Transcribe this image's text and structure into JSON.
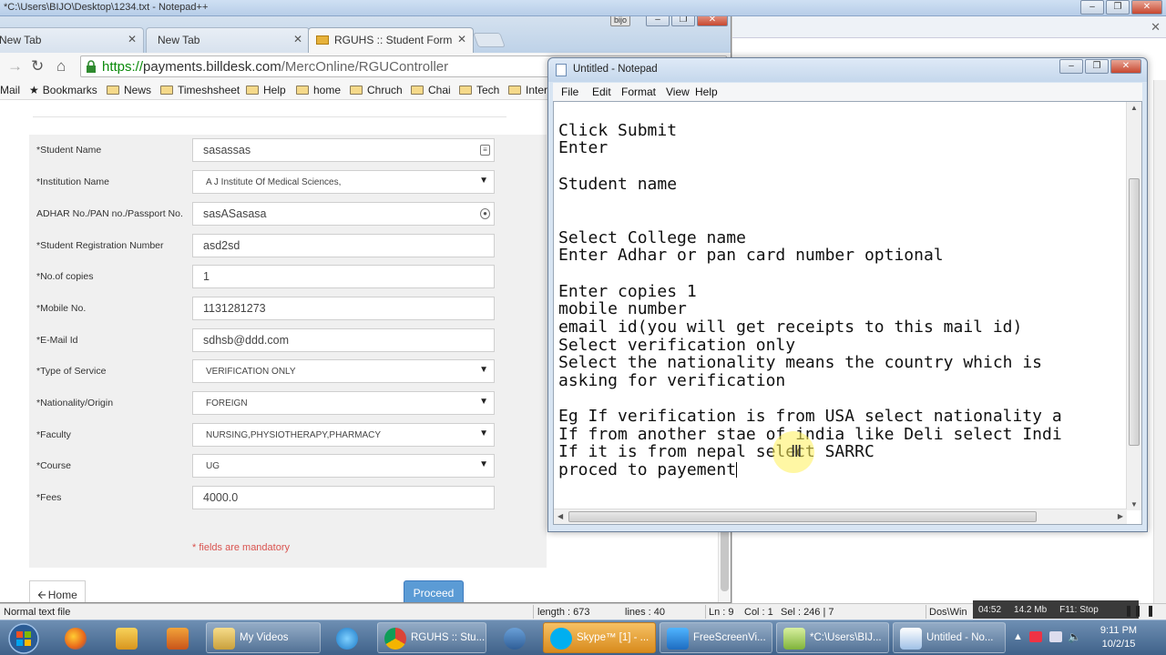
{
  "notepadpp": {
    "title": "*C:\\Users\\BIJO\\Desktop\\1234.txt - Notepad++",
    "statusbar": {
      "type": "Normal text file",
      "length": "length : 673",
      "lines": "lines : 40",
      "ln": "Ln : 9",
      "col": "Col : 1",
      "sel": "Sel : 246 | 7",
      "eol": "Dos\\Win"
    }
  },
  "recorder": {
    "time": "04:52",
    "size": "14.2 Mb",
    "hotkey": "F11: Stop"
  },
  "browser": {
    "tabs": [
      {
        "label": "New Tab",
        "active": false
      },
      {
        "label": "New Tab",
        "active": false
      },
      {
        "label": "RGUHS :: Student Form",
        "active": true
      }
    ],
    "window_badge": "bijo",
    "url": {
      "scheme": "https://",
      "host": "payments.billdesk.com",
      "path": "/MercOnline/RGUController"
    },
    "bookmarks": [
      "Mail",
      "Bookmarks",
      "News",
      "Timeshsheet",
      "Help",
      "home",
      "Chruch",
      "Chai",
      "Tech",
      "Inter"
    ]
  },
  "form": {
    "fields": [
      {
        "label": "*Student Name",
        "value": "sasassas",
        "kind": "text",
        "icon": "contact-card-icon"
      },
      {
        "label": "*Institution Name",
        "value": "A J Institute Of Medical Sciences,",
        "kind": "select"
      },
      {
        "label": "ADHAR No./PAN no./Passport No.",
        "value": "sasASasasa",
        "kind": "text",
        "icon": "key-icon"
      },
      {
        "label": "*Student Registration Number",
        "value": "asd2sd",
        "kind": "text"
      },
      {
        "label": "*No.of copies",
        "value": "1",
        "kind": "text"
      },
      {
        "label": "*Mobile No.",
        "value": "1131281273",
        "kind": "text"
      },
      {
        "label": "*E-Mail Id",
        "value": "sdhsb@ddd.com",
        "kind": "text"
      },
      {
        "label": "*Type of Service",
        "value": "VERIFICATION ONLY",
        "kind": "select"
      },
      {
        "label": "*Nationality/Origin",
        "value": "FOREIGN",
        "kind": "select"
      },
      {
        "label": "*Faculty",
        "value": "NURSING,PHYSIOTHERAPY,PHARMACY",
        "kind": "select"
      },
      {
        "label": "*Course",
        "value": "UG",
        "kind": "select"
      },
      {
        "label": "*Fees",
        "value": "4000.0",
        "kind": "text"
      }
    ],
    "mandatory_note": "* fields are mandatory",
    "home_button": "Home",
    "proceed_button": "Proceed"
  },
  "notepad": {
    "title": "Untitled - Notepad",
    "menu": [
      "File",
      "Edit",
      "Format",
      "View",
      "Help"
    ],
    "lines": [
      "Click Submit",
      "Enter",
      "",
      "Student name",
      "",
      "",
      "Select College name",
      "Enter Adhar or pan card number optional",
      "",
      "Enter copies 1",
      "mobile number",
      "email id(you will get receipts to this mail id)",
      "Select verification only",
      "Select the nationality means the country which is",
      "asking for verification",
      "",
      "Eg If verification is from USA select nationality a",
      "If from another stae of india like Deli select Indi",
      "If it is from nepal select SARRC",
      "proced to payement"
    ]
  },
  "taskbar": {
    "items": [
      {
        "label": "",
        "icon": "firefox-icon",
        "pinned": true
      },
      {
        "label": "",
        "icon": "outlook-icon",
        "pinned": true
      },
      {
        "label": "",
        "icon": "media-player-icon",
        "pinned": true
      },
      {
        "label": "My Videos",
        "icon": "folder-icon",
        "pinned": false
      },
      {
        "label": "",
        "icon": "internet-explorer-icon",
        "pinned": true
      },
      {
        "label": "RGUHS :: Stu...",
        "icon": "chrome-icon",
        "pinned": false
      },
      {
        "label": "",
        "icon": "link-icon",
        "pinned": true
      },
      {
        "label": "Skype™ [1] - ...",
        "icon": "skype-icon",
        "pinned": false,
        "highlight": true
      },
      {
        "label": "FreeScreenVi...",
        "icon": "screen-recorder-icon",
        "pinned": false
      },
      {
        "label": "*C:\\Users\\BIJ...",
        "icon": "notepadpp-icon",
        "pinned": false
      },
      {
        "label": "Untitled - No...",
        "icon": "notepad-icon",
        "pinned": false
      }
    ],
    "clock": {
      "time": "9:11 PM",
      "date": "10/2/15"
    }
  }
}
